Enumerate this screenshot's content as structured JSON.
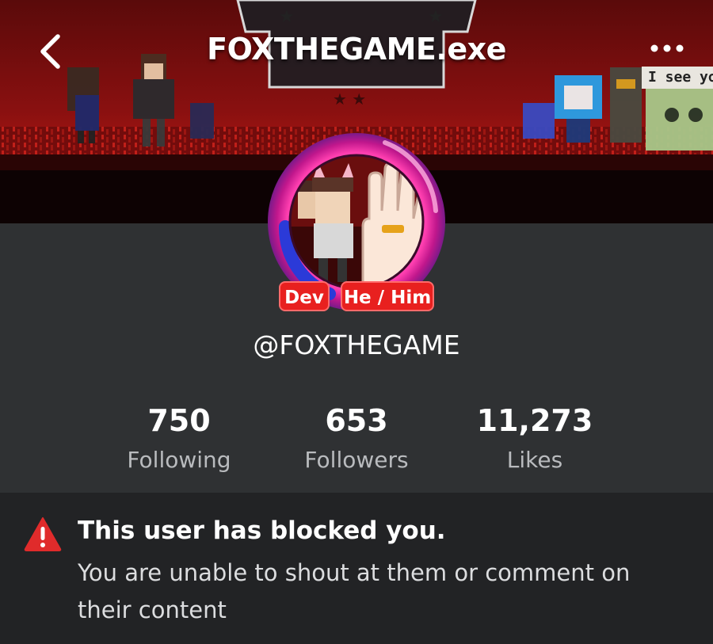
{
  "header": {
    "title": "FOXTHEGAME.exe",
    "back_icon": "chevron-left-icon",
    "more_icon": "more-dots-icon",
    "banner_caption": "I see you"
  },
  "profile": {
    "tags": {
      "role": "Dev",
      "pronouns": "He / Him"
    },
    "handle": "@FOXTHEGAME"
  },
  "stats": {
    "following": {
      "value": "750",
      "label": "Following"
    },
    "followers": {
      "value": "653",
      "label": "Followers"
    },
    "likes": {
      "value": "11,273",
      "label": "Likes"
    }
  },
  "notice": {
    "icon": "warning-icon",
    "title": "This user has blocked you.",
    "body": "You are unable to shout at them or comment on their content"
  },
  "colors": {
    "background": "#2f3133",
    "notice_background": "#222325",
    "tag_red": "#e8201f",
    "warning_red": "#e02b2b",
    "avatar_ring_pink": "#e0379e",
    "muted_text": "#b9bbbe"
  }
}
